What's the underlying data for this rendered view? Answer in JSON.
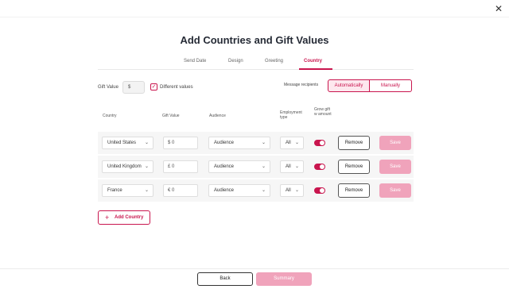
{
  "header": {
    "close_icon": "close-icon",
    "title": "Add Countries and Gift Values"
  },
  "tabs": [
    {
      "label": "Send Date",
      "active": false
    },
    {
      "label": "Design",
      "active": false
    },
    {
      "label": "Greeting",
      "active": false
    },
    {
      "label": "Country",
      "active": true
    }
  ],
  "gift_value": {
    "label": "Gift Value",
    "value": "$",
    "different_values_checked": true,
    "different_values_label": "Different values"
  },
  "message_recipients": {
    "label": "Message recipients",
    "options": [
      "Automatically",
      "Manually"
    ],
    "selected": "Automatically"
  },
  "table": {
    "headers": {
      "country": "Country",
      "gift_value": "Gift Value",
      "audience": "Audience",
      "employment_type": "Employment type",
      "grow_gift": "Grow gift w amount"
    },
    "rows": [
      {
        "country": "United States",
        "gift_value": "$ 0",
        "audience": "Audience",
        "employment": "All",
        "grow": true,
        "remove": "Remove",
        "save": "Save"
      },
      {
        "country": "United Kingdom",
        "gift_value": "£ 0",
        "audience": "Audience",
        "employment": "All",
        "grow": true,
        "remove": "Remove",
        "save": "Save"
      },
      {
        "country": "France",
        "gift_value": "€ 0",
        "audience": "Audience",
        "employment": "All",
        "grow": true,
        "remove": "Remove",
        "save": "Save"
      }
    ]
  },
  "add_country": {
    "label": "Add Country"
  },
  "footer": {
    "back": "Back",
    "summary": "Summary"
  },
  "colors": {
    "accent": "#c9154e",
    "accent_light": "#f0a3bb",
    "row_bg": "#f6f6f6"
  }
}
